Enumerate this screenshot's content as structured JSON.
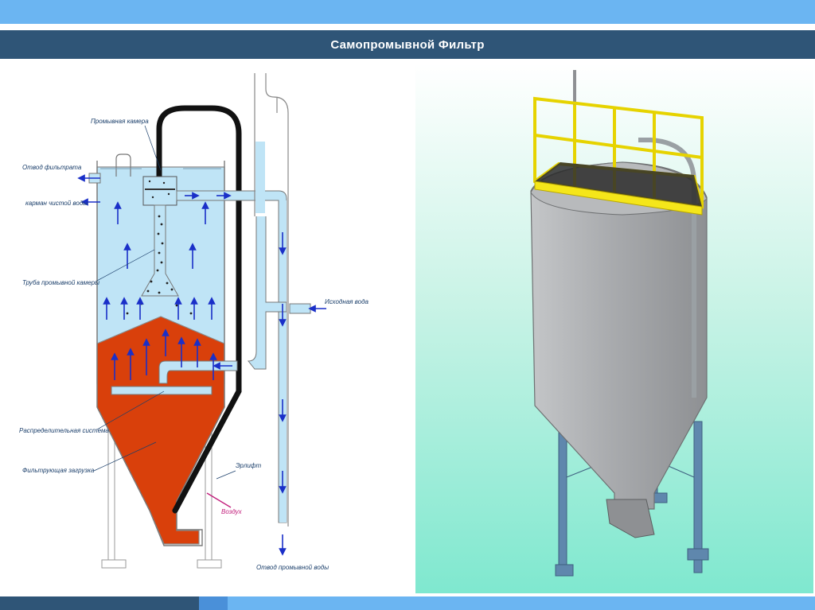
{
  "slide": {
    "title": "Самопромывной Фильтр"
  },
  "diagram": {
    "labels": {
      "wash_chamber": "Промывная камера",
      "filtrate_outlet": "Отвод фильтрата",
      "clean_water_pocket": "карман чистой воды",
      "wash_chamber_pipe": "Труба промывной камеры",
      "source_water": "Исходная вода",
      "distribution_system": "Распределительная система",
      "filter_media": "Фильтрующая загрузка",
      "airlift": "Эрлифт",
      "air": "Воздух",
      "wash_water_outlet": "Отвод промывной воды"
    },
    "colors": {
      "water": "#bfe4f6",
      "media": "#d9400b",
      "airlift_pipe": "#111111",
      "flow_arrow": "#1a2fc8",
      "air_arrow": "#c21f7c",
      "label_text": "#1b3f6b"
    }
  },
  "render3d": {
    "colors": {
      "background_top": "#ffffff",
      "background_bottom": "#7fe8cf",
      "tank": "#a9abae",
      "platform": "#f5e61a",
      "legs": "#5f87ad"
    }
  }
}
